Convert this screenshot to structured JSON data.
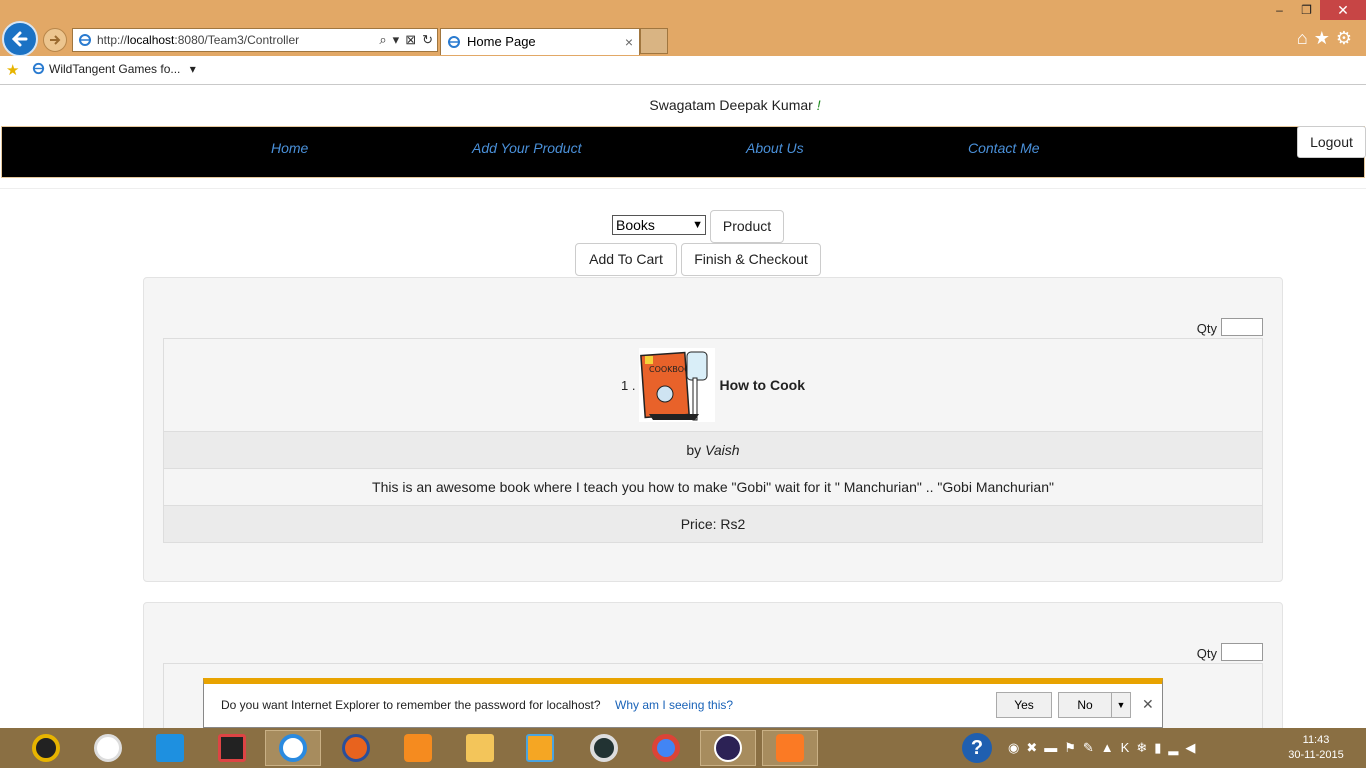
{
  "browser": {
    "url_prefix": "http://",
    "url_host": "localhost",
    "url_path": ":8080/Team3/Controller",
    "tab_title": "Home Page",
    "tab_close": "×",
    "favorites_item": "WildTangent Games fo...",
    "favorites_caret": "▾",
    "win_minimize": "–",
    "win_restore": "❐",
    "win_close": "✕",
    "right_icons": "⌂★⚙",
    "addr_icons": [
      "⌕",
      "▾",
      "⊠",
      "↻"
    ]
  },
  "page": {
    "welcome_text": "Swagatam Deepak Kumar",
    "welcome_bang": "!",
    "nav": [
      "Home",
      "Add Your Product",
      "About Us",
      "Contact Me"
    ],
    "logout": "Logout",
    "category_selected": "Books",
    "category_arrow": "▼",
    "product_button": "Product",
    "add_to_cart": "Add To Cart",
    "finish_checkout": "Finish & Checkout",
    "qty_label": "Qty",
    "products": [
      {
        "index": "1 .",
        "title": "How to Cook",
        "by_prefix": "by",
        "author": "Vaish",
        "description": "This is an awesome book where I teach you how to make \"Gobi\" wait for it \" Manchurian\" .. \"Gobi Manchurian\"",
        "price": "Price: Rs2"
      }
    ]
  },
  "password_bar": {
    "question": "Do you want Internet Explorer to remember the password for localhost?",
    "why_link": "Why am I seeing this?",
    "yes": "Yes",
    "no": "No",
    "dropdown": "▼",
    "close": "✕"
  },
  "taskbar": {
    "apps": [
      "media-player",
      "hp",
      "rocket",
      "colorful-app",
      "internet-explorer",
      "firefox",
      "vlc",
      "file-explorer",
      "video-player",
      "eye-app",
      "chrome",
      "eclipse",
      "xampp"
    ],
    "help": "?",
    "tray_icons": "◉✖▬⚑✎▲K❄▮▂◀",
    "time": "11:43",
    "date": "30-11-2015"
  }
}
